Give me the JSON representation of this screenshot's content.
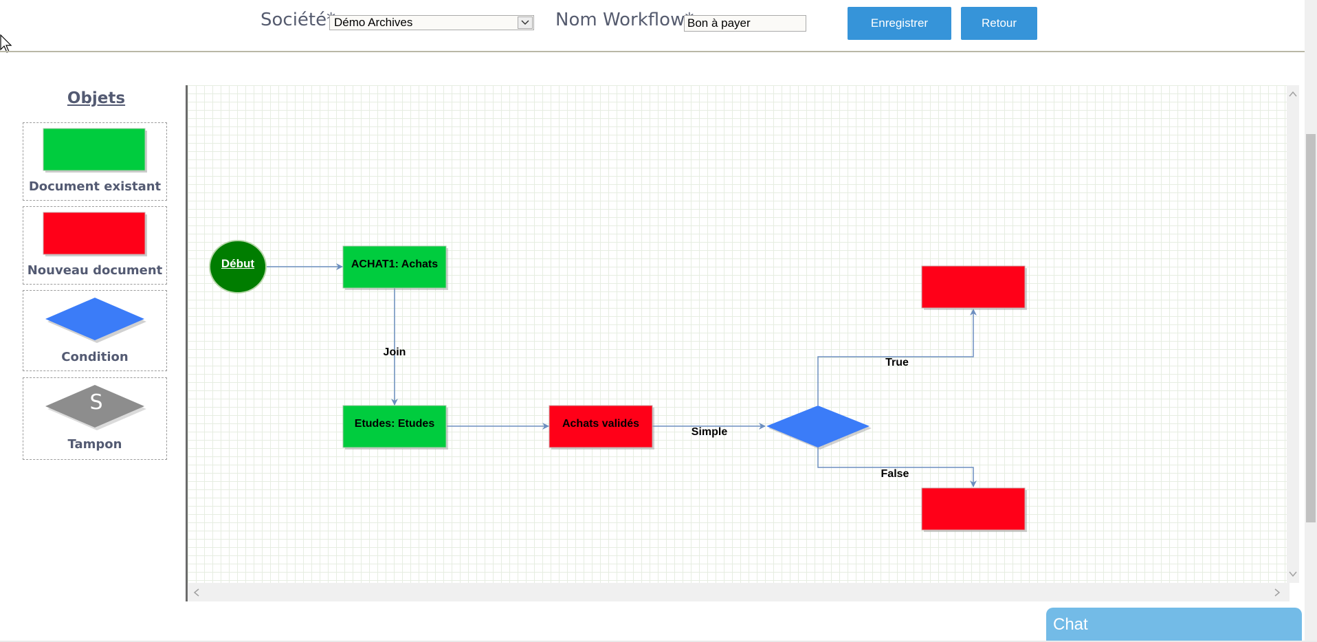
{
  "header": {
    "societe_label": "Société*:",
    "societe_value": "Démo Archives",
    "workflow_label": "Nom Workflow*:",
    "workflow_value": "Bon à payer",
    "save_label": "Enregistrer",
    "back_label": "Retour"
  },
  "palette": {
    "title": "Objets",
    "items": [
      {
        "label": "Document existant",
        "icon": "green-rectangle-icon",
        "color": "#00cc3e"
      },
      {
        "label": "Nouveau document",
        "icon": "red-rectangle-icon",
        "color": "#ff0018"
      },
      {
        "label": "Condition",
        "icon": "blue-diamond-icon",
        "color": "#3b7cf8"
      },
      {
        "label": "Tampon",
        "icon": "gray-stamp-diamond-icon",
        "color": "#8d8d8d",
        "symbol": "S"
      }
    ]
  },
  "diagram": {
    "start_label": "Début",
    "node_achat": "ACHAT1: Achats",
    "node_etudes": "Etudes: Etudes",
    "node_achats_valides": "Achats validés",
    "edge_join": "Join",
    "edge_simple": "Simple",
    "edge_true": "True",
    "edge_false": "False"
  },
  "colors": {
    "accent": "#3694d9",
    "existing_doc": "#00cc3e",
    "new_doc": "#ff0018",
    "condition": "#3b7cf8",
    "start": "#007d00",
    "connector": "#6c8ebf"
  },
  "chat": {
    "label": "Chat"
  }
}
